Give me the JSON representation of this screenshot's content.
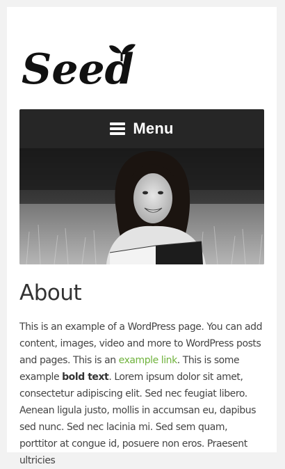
{
  "site": {
    "logo_text": "Seed"
  },
  "nav": {
    "menu_label": "Menu",
    "menu_icon": "hamburger-icon"
  },
  "hero": {
    "image": "photo of smiling young woman lying in grass reading a book"
  },
  "content": {
    "title": "About",
    "paragraph": {
      "part1": "This is an example of a WordPress page. You can add content, images, video and more to WordPress posts and pages. This is an ",
      "link_text": "example link",
      "part2": ". This is some example ",
      "bold_text": "bold text",
      "part3": ". Lorem ipsum dolor sit amet, consectetur adipiscing elit. Sed nec feugiat libero. Aenean ligula justo, mollis in accumsan eu, dapibus sed nunc. Sed nec lacinia mi. Sed sem quam, porttitor at congue id, posuere non eros. Praesent ultricies"
    }
  },
  "colors": {
    "menu_bg": "#262626",
    "link": "#6fb23c",
    "page_bg": "#ffffff",
    "outer_bg": "#f2f2f2"
  }
}
